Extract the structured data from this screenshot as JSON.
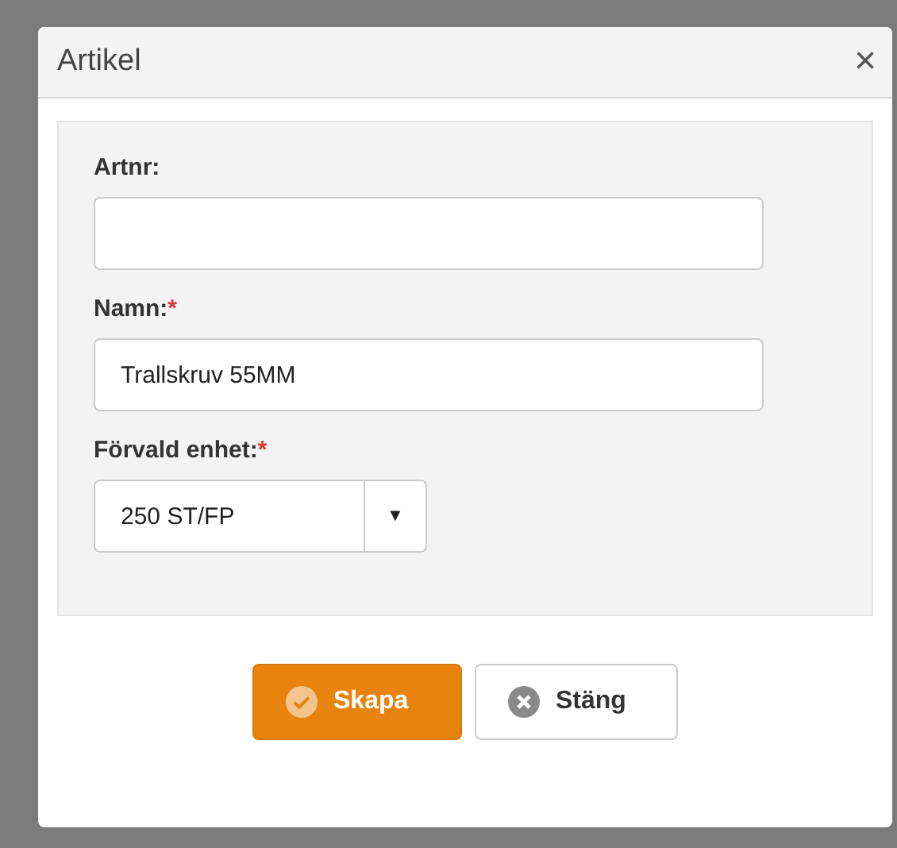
{
  "dialog": {
    "title": "Artikel",
    "close": "×"
  },
  "fields": [
    {
      "kind": "text",
      "label": "Artnr:"
    },
    {
      "kind": "text",
      "label": "Namn:",
      "marker": "*",
      "value": "Trallskruv 55MM"
    },
    {
      "kind": "select",
      "label": "Förvald enhet:",
      "marker": "*",
      "value": "250 ST/FP",
      "caret": "▼"
    }
  ],
  "buttons": [
    {
      "kind": "primary",
      "label": "Skapa"
    },
    {
      "kind": "default",
      "label": "Stäng"
    }
  ]
}
